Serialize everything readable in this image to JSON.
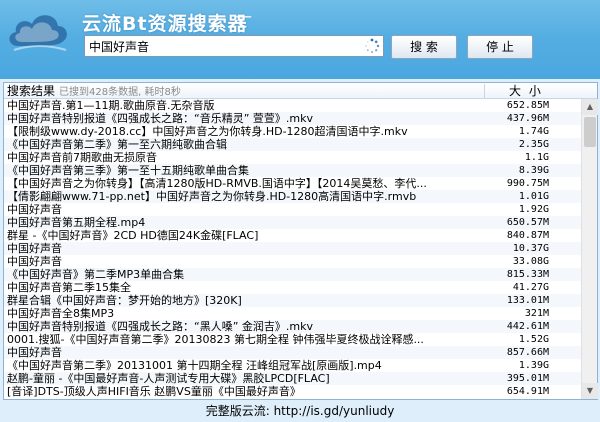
{
  "app": {
    "title": "云流Bt资源搜索器",
    "minimize_label": "—"
  },
  "search": {
    "value": "中国好声音",
    "search_label": "搜 索",
    "stop_label": "停 止"
  },
  "results": {
    "header_name": "搜索结果",
    "status_text": "已搜到428条数据, 耗时8秒",
    "header_size": "大 小",
    "rows": [
      {
        "name": "中国好声音.第1—11期.歌曲原音.无杂音版",
        "size": "652.85M"
      },
      {
        "name": "中国好声音特别报道《四强成长之路：“音乐精灵” 萱萱》.mkv",
        "size": "437.96M"
      },
      {
        "name": "【限制级www.dy-2018.cc】中国好声音之为你转身.HD-1280超清国语中字.mkv",
        "size": "1.74G"
      },
      {
        "name": "《中国好声音第二季》第一至六期纯歌曲合辑",
        "size": "2.35G"
      },
      {
        "name": "中国好声音前7期歌曲无损原音",
        "size": "1.1G"
      },
      {
        "name": "《中国好声音第三季》第一至十五期纯歌单曲合集",
        "size": "8.39G"
      },
      {
        "name": "【中国好声音之为你转身】【高清1280版HD-RMVB.国语中字】【2014吴莫愁、李代...",
        "size": "990.75M"
      },
      {
        "name": "【倩影翩翩www.71-pp.net】中国好声音之为你转身.HD-1280高清国语中字.rmvb",
        "size": "1.01G"
      },
      {
        "name": "中国好声音",
        "size": "1.92G"
      },
      {
        "name": "中国好声音第五期全程.mp4",
        "size": "650.57M"
      },
      {
        "name": "群星 -《中国好声音》2CD HD德国24K金碟[FLAC]",
        "size": "840.87M"
      },
      {
        "name": "中国好声音",
        "size": "10.37G"
      },
      {
        "name": "中国好声音",
        "size": "33.08G"
      },
      {
        "name": "《中国好声音》第二季MP3单曲合集",
        "size": "815.33M"
      },
      {
        "name": "中国好声音第二季15集全",
        "size": "41.27G"
      },
      {
        "name": "群星合辑《中国好声音：梦开始的地方》[320K]",
        "size": "133.01M"
      },
      {
        "name": "中国好声音全8集MP3",
        "size": "321M"
      },
      {
        "name": "中国好声音特别报道《四强成长之路：“黑人嗓” 金润吉》.mkv",
        "size": "442.61M"
      },
      {
        "name": "0001.搜狐-《中国好声音第二季》20130823 第七期全程 钟伟强毕夏终极战诠释感...",
        "size": "1.52G"
      },
      {
        "name": "中国好声音",
        "size": "857.66M"
      },
      {
        "name": "《中国好声音第二季》20131001 第十四期全程 汪峰组冠军战[原画版].mp4",
        "size": "1.39G"
      },
      {
        "name": "赵鹏-童丽 -《中国最好声音-人声测试专用大碟》黑胶LPCD[FLAC]",
        "size": "395.01M"
      },
      {
        "name": "[音译]DTS-顶级人声HIFI音乐 赵鹏VS童丽《中国最好声音》",
        "size": "654.91M"
      }
    ]
  },
  "footer": {
    "label": "完整版云流:",
    "url": "http://is.gd/yunliudy"
  },
  "colors": {
    "header_bg": "#55aee2",
    "window_bg": "#dfeefb",
    "loading_icon": "#2f6fb8"
  },
  "icons": {
    "logo": "cloud-logo-icon",
    "loading": "loading-spinner-icon",
    "scroll_up": "scroll-up-arrow-icon",
    "scroll_down": "scroll-down-arrow-icon"
  }
}
